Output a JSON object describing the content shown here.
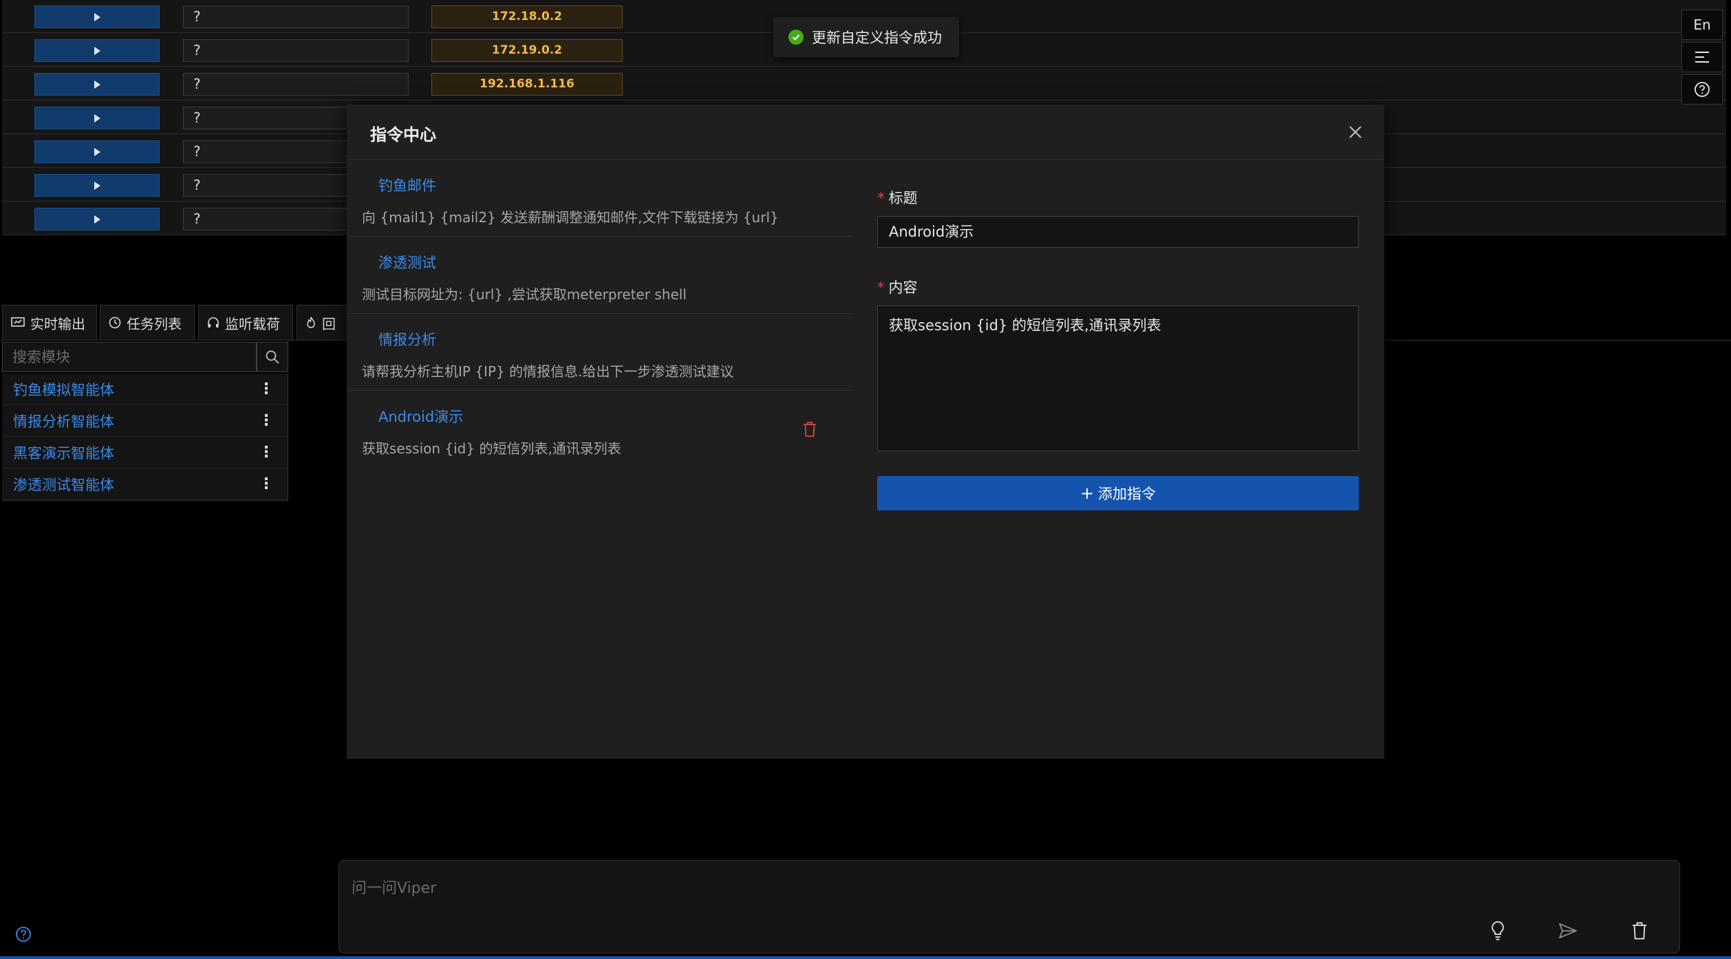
{
  "sessions": [
    {
      "placeholder": "?",
      "ip": "172.18.0.2"
    },
    {
      "placeholder": "?",
      "ip": "172.19.0.2"
    },
    {
      "placeholder": "?",
      "ip": "192.168.1.116"
    },
    {
      "placeholder": "?",
      "ip": ""
    },
    {
      "placeholder": "?",
      "ip": ""
    },
    {
      "placeholder": "?",
      "ip": ""
    },
    {
      "placeholder": "?",
      "ip": ""
    }
  ],
  "side_toolbar": {
    "lang_label": "En",
    "menu_icon": "menu-lines-icon",
    "help_icon": "question-circle-icon"
  },
  "toast": {
    "message": "更新自定义指令成功",
    "icon": "check-circle-icon",
    "color": "#49aa19"
  },
  "tabs": [
    {
      "label": "实时输出",
      "icon": "monitor-icon"
    },
    {
      "label": "任务列表",
      "icon": "clock-icon"
    },
    {
      "label": "监听载荷",
      "icon": "headphones-icon"
    },
    {
      "label": "回",
      "icon": "fire-icon"
    }
  ],
  "modules": {
    "search_placeholder": "搜索模块",
    "items": [
      {
        "label": "钓鱼模拟智能体"
      },
      {
        "label": "情报分析智能体"
      },
      {
        "label": "黑客演示智能体"
      },
      {
        "label": "渗透测试智能体"
      }
    ]
  },
  "modal": {
    "title": "指令中心",
    "commands": [
      {
        "name": "钓鱼邮件",
        "content": "向 {mail1} {mail2} 发送薪酬调整通知邮件,文件下载链接为 {url}"
      },
      {
        "name": "渗透测试",
        "content": "测试目标网址为: {url} ,尝试获取meterpreter shell"
      },
      {
        "name": "情报分析",
        "content": "请帮我分析主机IP {IP} 的情报信息.给出下一步渗透测试建议"
      },
      {
        "name": "Android演示",
        "content": "获取session {id} 的短信列表,通讯录列表"
      }
    ],
    "form": {
      "title_label": "标题",
      "title_value": "Android演示",
      "content_label": "内容",
      "content_value": "获取session {id} 的短信列表,通讯录列表",
      "submit_label": "添加指令"
    }
  },
  "chat": {
    "placeholder": "问一问Viper"
  },
  "colors": {
    "accent": "#1554ad",
    "link": "#3c89e8",
    "ip": "#f2b94a",
    "danger": "#dc4446"
  }
}
